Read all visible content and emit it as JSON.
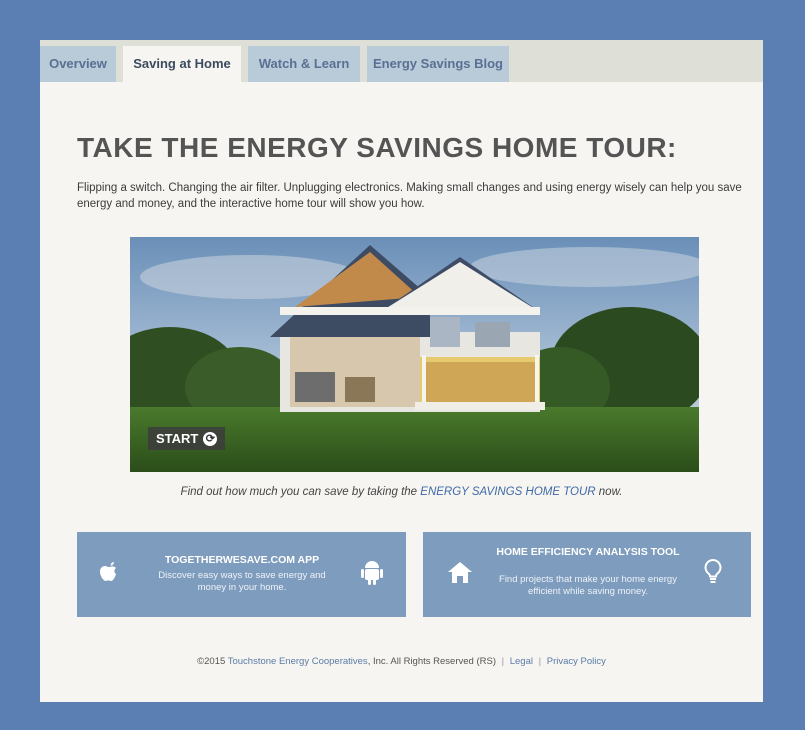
{
  "tabs": [
    {
      "label": "Overview"
    },
    {
      "label": "Saving at Home",
      "active": true
    },
    {
      "label": "Watch & Learn"
    },
    {
      "label": "Energy Savings Blog"
    }
  ],
  "main": {
    "title": "TAKE THE ENERGY SAVINGS HOME TOUR:",
    "intro": "Flipping a switch.  Changing the air filter.  Unplugging electronics. Making small changes and using energy wisely can help you save energy and money, and the interactive home tour will show you how.",
    "hero": {
      "start_label": "START"
    },
    "caption_pre": "Find out how much you can save by taking the ",
    "caption_link": "ENERGY SAVINGS HOME TOUR",
    "caption_post": " now."
  },
  "cta": [
    {
      "title": "TOGETHERWESAVE.COM APP",
      "desc": "Discover easy ways to save energy and money in your home."
    },
    {
      "title": "HOME EFFICIENCY ANALYSIS TOOL",
      "desc": "Find projects that make your home energy efficient while saving money."
    }
  ],
  "footer": {
    "copy_pre": "©2015 ",
    "copy_link": "Touchstone Energy Cooperatives",
    "copy_post": ", Inc. All Rights Reserved (RS)",
    "legal": "Legal",
    "privacy": "Privacy Policy"
  },
  "colors": {
    "outer_bg": "#5b7fb3",
    "tab_bg": "#b9cad9",
    "cta_bg": "#7e9cbd",
    "link": "#3f6aa8"
  }
}
